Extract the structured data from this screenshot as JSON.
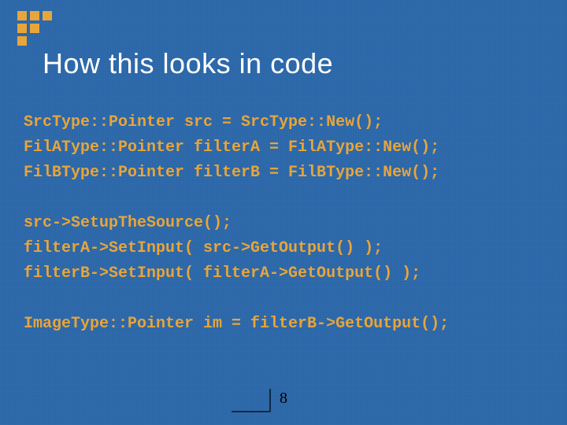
{
  "slide": {
    "title": "How this looks in code",
    "page_number": "8"
  },
  "code": {
    "line1": "SrcType::Pointer src = SrcType::New();",
    "line2": "FilAType::Pointer filterA = FilAType::New();",
    "line3": "FilBType::Pointer filterB = FilBType::New();",
    "line4": "",
    "line5": "src->SetupTheSource();",
    "line6": "filterA->SetInput( src->GetOutput() );",
    "line7": "filterB->SetInput( filterA->GetOutput() );",
    "line8": "",
    "line9": "ImageType::Pointer im = filterB->GetOutput();"
  }
}
